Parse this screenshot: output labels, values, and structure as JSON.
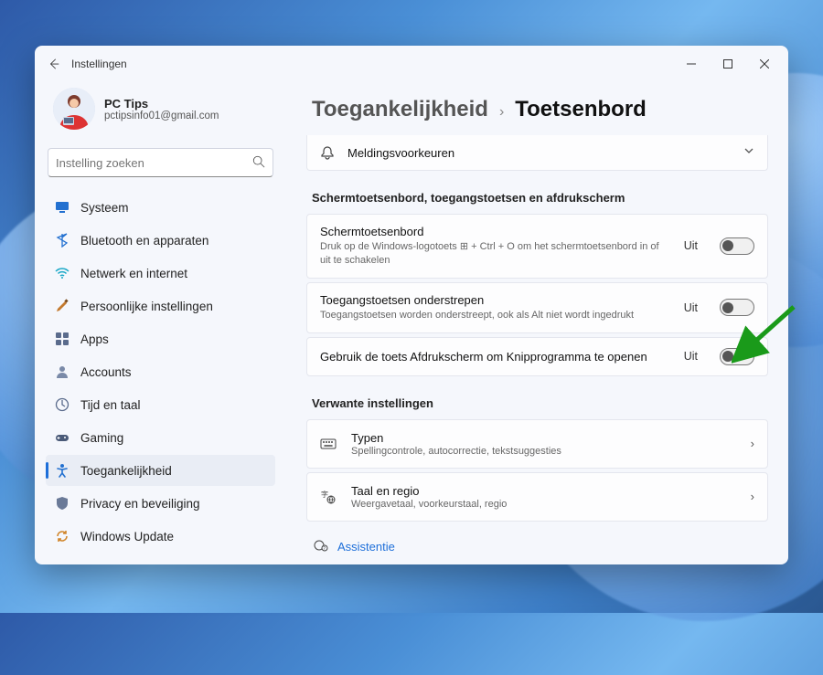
{
  "window": {
    "title": "Instellingen"
  },
  "user": {
    "name": "PC Tips",
    "email": "pctipsinfo01@gmail.com"
  },
  "search": {
    "placeholder": "Instelling zoeken"
  },
  "nav": [
    {
      "label": "Systeem"
    },
    {
      "label": "Bluetooth en apparaten"
    },
    {
      "label": "Netwerk en internet"
    },
    {
      "label": "Persoonlijke instellingen"
    },
    {
      "label": "Apps"
    },
    {
      "label": "Accounts"
    },
    {
      "label": "Tijd en taal"
    },
    {
      "label": "Gaming"
    },
    {
      "label": "Toegankelijkheid"
    },
    {
      "label": "Privacy en beveiliging"
    },
    {
      "label": "Windows Update"
    }
  ],
  "breadcrumb": {
    "parent": "Toegankelijkheid",
    "current": "Toetsenbord"
  },
  "clipped_row": {
    "title": "Meldingsvoorkeuren"
  },
  "section1": {
    "heading": "Schermtoetsenbord, toegangstoetsen en afdrukscherm",
    "items": [
      {
        "title": "Schermtoetsenbord",
        "sub": "Druk op de Windows-logotoets ⊞ + Ctrl + O om het schermtoetsenbord in of uit te schakelen",
        "state": "Uit"
      },
      {
        "title": "Toegangstoetsen onderstrepen",
        "sub": "Toegangstoetsen worden onderstreept, ook als Alt niet wordt ingedrukt",
        "state": "Uit"
      },
      {
        "title": "Gebruik de toets Afdrukscherm om Knipprogramma te openen",
        "sub": "",
        "state": "Uit"
      }
    ]
  },
  "section2": {
    "heading": "Verwante instellingen",
    "items": [
      {
        "title": "Typen",
        "sub": "Spellingcontrole, autocorrectie, tekstsuggesties"
      },
      {
        "title": "Taal en regio",
        "sub": "Weergavetaal, voorkeurstaal, regio"
      }
    ]
  },
  "assist": {
    "label": "Assistentie"
  }
}
